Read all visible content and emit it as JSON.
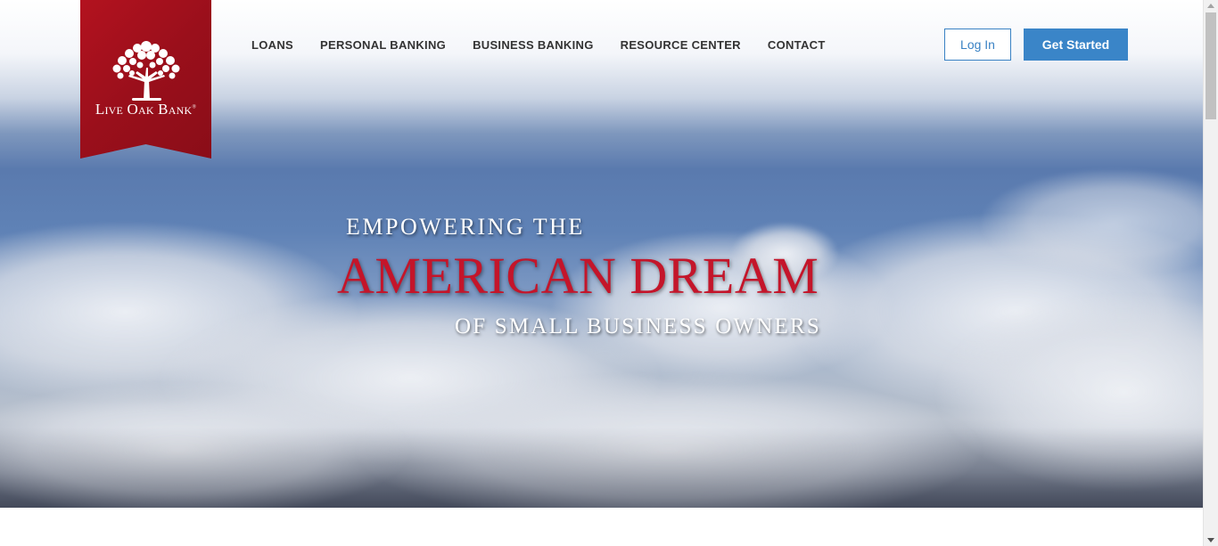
{
  "brand": {
    "name": "Live Oak Bank",
    "name_display": "Live Oak Bank",
    "trademark": "®",
    "logo_icon": "oak-tree-icon",
    "banner_color": "#a3101c"
  },
  "nav": {
    "items": [
      {
        "label": "LOANS"
      },
      {
        "label": "PERSONAL BANKING"
      },
      {
        "label": "BUSINESS BANKING"
      },
      {
        "label": "RESOURCE CENTER"
      },
      {
        "label": "CONTACT"
      }
    ]
  },
  "actions": {
    "login_label": "Log In",
    "get_started_label": "Get Started",
    "accent_color": "#3a85c8"
  },
  "hero": {
    "line1": "EMPOWERING THE",
    "line2": "AMERICAN DREAM",
    "line3": "OF SMALL BUSINESS OWNERS",
    "headline_accent_color": "#c4152a",
    "background": "cloudy-sky"
  }
}
